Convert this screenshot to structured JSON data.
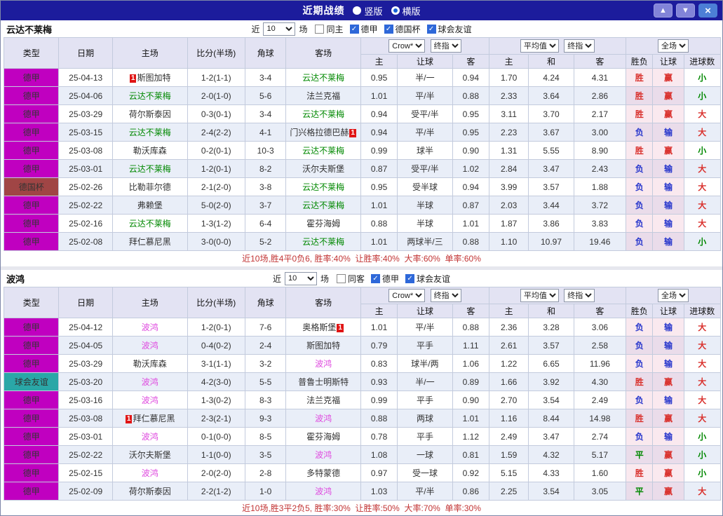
{
  "colors": {
    "titlebar_bg": "#1c1c9c",
    "type": {
      "德甲": "#c000c0",
      "德国杯": "#a04545",
      "球会友谊": "#2aa7a7"
    },
    "text": {
      "green": "#008800",
      "pink": "#df4bdf",
      "red": "#d9302c",
      "blue": "#2736cc"
    }
  },
  "titlebar": {
    "title": "近期战绩",
    "view_options": [
      {
        "label": "竖版",
        "selected": false
      },
      {
        "label": "横版",
        "selected": true
      }
    ],
    "buttons": {
      "up": "▲",
      "down": "▼",
      "close": "×"
    }
  },
  "sections": [
    {
      "team": "云达不莱梅",
      "filter": {
        "prefix": "近",
        "count": "10",
        "suffix": "场",
        "checkboxes": [
          {
            "label": "同主",
            "checked": false
          },
          {
            "label": "德甲",
            "checked": true
          },
          {
            "label": "德国杯",
            "checked": true
          },
          {
            "label": "球会友谊",
            "checked": true
          }
        ]
      },
      "header": {
        "cols": [
          "类型",
          "日期",
          "主场",
          "比分(半场)",
          "角球",
          "客场"
        ],
        "asian_selects": [
          "Crow*",
          "终指"
        ],
        "euro_selects": [
          "平均值",
          "终指"
        ],
        "result_select": "全场",
        "subcols": [
          "主",
          "让球",
          "客",
          "主",
          "和",
          "客",
          "胜负",
          "让球",
          "进球数"
        ]
      },
      "rows": [
        {
          "type": "德甲",
          "date": "25-04-13",
          "home": {
            "name": "斯图加特",
            "badge": "1",
            "badge_pos": "before"
          },
          "score": "1-2(1-1)",
          "corner": "3-4",
          "away": {
            "name": "云达不莱梅",
            "color": "green"
          },
          "asian": [
            "0.95",
            "半/一",
            "0.94"
          ],
          "euro": [
            "1.70",
            "4.24",
            "4.31"
          ],
          "result": {
            "text": "胜",
            "color": "red"
          },
          "handicap": {
            "text": "赢",
            "color": "red"
          },
          "goals": {
            "text": "小",
            "color": "green"
          }
        },
        {
          "type": "德甲",
          "date": "25-04-06",
          "home": {
            "name": "云达不莱梅",
            "color": "green"
          },
          "score": "2-0(1-0)",
          "corner": "5-6",
          "away": {
            "name": "法兰克福"
          },
          "asian": [
            "1.01",
            "平/半",
            "0.88"
          ],
          "euro": [
            "2.33",
            "3.64",
            "2.86"
          ],
          "result": {
            "text": "胜",
            "color": "red"
          },
          "handicap": {
            "text": "赢",
            "color": "red"
          },
          "goals": {
            "text": "小",
            "color": "green"
          }
        },
        {
          "type": "德甲",
          "date": "25-03-29",
          "home": {
            "name": "荷尔斯泰因"
          },
          "score": "0-3(0-1)",
          "corner": "3-4",
          "away": {
            "name": "云达不莱梅",
            "color": "green"
          },
          "asian": [
            "0.94",
            "受平/半",
            "0.95"
          ],
          "euro": [
            "3.11",
            "3.70",
            "2.17"
          ],
          "result": {
            "text": "胜",
            "color": "red"
          },
          "handicap": {
            "text": "赢",
            "color": "red"
          },
          "goals": {
            "text": "大",
            "color": "red"
          }
        },
        {
          "type": "德甲",
          "date": "25-03-15",
          "home": {
            "name": "云达不莱梅",
            "color": "green"
          },
          "score": "2-4(2-2)",
          "corner": "4-1",
          "away": {
            "name": "门兴格拉德巴赫",
            "badge": "1",
            "badge_pos": "after"
          },
          "asian": [
            "0.94",
            "平/半",
            "0.95"
          ],
          "euro": [
            "2.23",
            "3.67",
            "3.00"
          ],
          "result": {
            "text": "负",
            "color": "blue"
          },
          "handicap": {
            "text": "输",
            "color": "blue"
          },
          "goals": {
            "text": "大",
            "color": "red"
          }
        },
        {
          "type": "德甲",
          "date": "25-03-08",
          "home": {
            "name": "勒沃库森"
          },
          "score": "0-2(0-1)",
          "corner": "10-3",
          "away": {
            "name": "云达不莱梅",
            "color": "green"
          },
          "asian": [
            "0.99",
            "球半",
            "0.90"
          ],
          "euro": [
            "1.31",
            "5.55",
            "8.90"
          ],
          "result": {
            "text": "胜",
            "color": "red"
          },
          "handicap": {
            "text": "赢",
            "color": "red"
          },
          "goals": {
            "text": "小",
            "color": "green"
          }
        },
        {
          "type": "德甲",
          "date": "25-03-01",
          "home": {
            "name": "云达不莱梅",
            "color": "green"
          },
          "score": "1-2(0-1)",
          "corner": "8-2",
          "away": {
            "name": "沃尔夫斯堡"
          },
          "asian": [
            "0.87",
            "受平/半",
            "1.02"
          ],
          "euro": [
            "2.84",
            "3.47",
            "2.43"
          ],
          "result": {
            "text": "负",
            "color": "blue"
          },
          "handicap": {
            "text": "输",
            "color": "blue"
          },
          "goals": {
            "text": "大",
            "color": "red"
          }
        },
        {
          "type": "德国杯",
          "date": "25-02-26",
          "home": {
            "name": "比勒菲尔德"
          },
          "score": "2-1(2-0)",
          "corner": "3-8",
          "away": {
            "name": "云达不莱梅",
            "color": "green"
          },
          "asian": [
            "0.95",
            "受半球",
            "0.94"
          ],
          "euro": [
            "3.99",
            "3.57",
            "1.88"
          ],
          "result": {
            "text": "负",
            "color": "blue"
          },
          "handicap": {
            "text": "输",
            "color": "blue"
          },
          "goals": {
            "text": "大",
            "color": "red"
          }
        },
        {
          "type": "德甲",
          "date": "25-02-22",
          "home": {
            "name": "弗赖堡"
          },
          "score": "5-0(2-0)",
          "corner": "3-7",
          "away": {
            "name": "云达不莱梅",
            "color": "green"
          },
          "asian": [
            "1.01",
            "半球",
            "0.87"
          ],
          "euro": [
            "2.03",
            "3.44",
            "3.72"
          ],
          "result": {
            "text": "负",
            "color": "blue"
          },
          "handicap": {
            "text": "输",
            "color": "blue"
          },
          "goals": {
            "text": "大",
            "color": "red"
          }
        },
        {
          "type": "德甲",
          "date": "25-02-16",
          "home": {
            "name": "云达不莱梅",
            "color": "green"
          },
          "score": "1-3(1-2)",
          "corner": "6-4",
          "away": {
            "name": "霍芬海姆"
          },
          "asian": [
            "0.88",
            "半球",
            "1.01"
          ],
          "euro": [
            "1.87",
            "3.86",
            "3.83"
          ],
          "result": {
            "text": "负",
            "color": "blue"
          },
          "handicap": {
            "text": "输",
            "color": "blue"
          },
          "goals": {
            "text": "大",
            "color": "red"
          }
        },
        {
          "type": "德甲",
          "date": "25-02-08",
          "home": {
            "name": "拜仁慕尼黑"
          },
          "score": "3-0(0-0)",
          "corner": "5-2",
          "away": {
            "name": "云达不莱梅",
            "color": "green"
          },
          "asian": [
            "1.01",
            "两球半/三",
            "0.88"
          ],
          "euro": [
            "1.10",
            "10.97",
            "19.46"
          ],
          "result": {
            "text": "负",
            "color": "blue"
          },
          "handicap": {
            "text": "输",
            "color": "blue"
          },
          "goals": {
            "text": "小",
            "color": "green"
          }
        }
      ],
      "footer": "近10场,胜4平0负6, 胜率:40%  让胜率:40%  大率:60%  单率:60%"
    },
    {
      "team": "波鸿",
      "filter": {
        "prefix": "近",
        "count": "10",
        "suffix": "场",
        "checkboxes": [
          {
            "label": "同客",
            "checked": false
          },
          {
            "label": "德甲",
            "checked": true
          },
          {
            "label": "球会友谊",
            "checked": true
          }
        ]
      },
      "header": {
        "cols": [
          "类型",
          "日期",
          "主场",
          "比分(半场)",
          "角球",
          "客场"
        ],
        "asian_selects": [
          "Crow*",
          "终指"
        ],
        "euro_selects": [
          "平均值",
          "终指"
        ],
        "result_select": "全场",
        "subcols": [
          "主",
          "让球",
          "客",
          "主",
          "和",
          "客",
          "胜负",
          "让球",
          "进球数"
        ]
      },
      "rows": [
        {
          "type": "德甲",
          "date": "25-04-12",
          "home": {
            "name": "波鸿",
            "color": "pink"
          },
          "score": "1-2(0-1)",
          "corner": "7-6",
          "away": {
            "name": "奥格斯堡",
            "badge": "1",
            "badge_pos": "after"
          },
          "asian": [
            "1.01",
            "平/半",
            "0.88"
          ],
          "euro": [
            "2.36",
            "3.28",
            "3.06"
          ],
          "result": {
            "text": "负",
            "color": "blue"
          },
          "handicap": {
            "text": "输",
            "color": "blue"
          },
          "goals": {
            "text": "大",
            "color": "red"
          }
        },
        {
          "type": "德甲",
          "date": "25-04-05",
          "home": {
            "name": "波鸿",
            "color": "pink"
          },
          "score": "0-4(0-2)",
          "corner": "2-4",
          "away": {
            "name": "斯图加特"
          },
          "asian": [
            "0.79",
            "平手",
            "1.11"
          ],
          "euro": [
            "2.61",
            "3.57",
            "2.58"
          ],
          "result": {
            "text": "负",
            "color": "blue"
          },
          "handicap": {
            "text": "输",
            "color": "blue"
          },
          "goals": {
            "text": "大",
            "color": "red"
          }
        },
        {
          "type": "德甲",
          "date": "25-03-29",
          "home": {
            "name": "勒沃库森"
          },
          "score": "3-1(1-1)",
          "corner": "3-2",
          "away": {
            "name": "波鸿",
            "color": "pink"
          },
          "asian": [
            "0.83",
            "球半/两",
            "1.06"
          ],
          "euro": [
            "1.22",
            "6.65",
            "11.96"
          ],
          "result": {
            "text": "负",
            "color": "blue"
          },
          "handicap": {
            "text": "输",
            "color": "blue"
          },
          "goals": {
            "text": "大",
            "color": "red"
          }
        },
        {
          "type": "球会友谊",
          "date": "25-03-20",
          "home": {
            "name": "波鸿",
            "color": "pink"
          },
          "score": "4-2(3-0)",
          "corner": "5-5",
          "away": {
            "name": "普鲁士明斯特"
          },
          "asian": [
            "0.93",
            "半/一",
            "0.89"
          ],
          "euro": [
            "1.66",
            "3.92",
            "4.30"
          ],
          "result": {
            "text": "胜",
            "color": "red"
          },
          "handicap": {
            "text": "赢",
            "color": "red"
          },
          "goals": {
            "text": "大",
            "color": "red"
          }
        },
        {
          "type": "德甲",
          "date": "25-03-16",
          "home": {
            "name": "波鸿",
            "color": "pink"
          },
          "score": "1-3(0-2)",
          "corner": "8-3",
          "away": {
            "name": "法兰克福"
          },
          "asian": [
            "0.99",
            "平手",
            "0.90"
          ],
          "euro": [
            "2.70",
            "3.54",
            "2.49"
          ],
          "result": {
            "text": "负",
            "color": "blue"
          },
          "handicap": {
            "text": "输",
            "color": "blue"
          },
          "goals": {
            "text": "大",
            "color": "red"
          }
        },
        {
          "type": "德甲",
          "date": "25-03-08",
          "home": {
            "name": "拜仁慕尼黑",
            "badge": "1",
            "badge_pos": "before"
          },
          "score": "2-3(2-1)",
          "corner": "9-3",
          "away": {
            "name": "波鸿",
            "color": "pink"
          },
          "asian": [
            "0.88",
            "两球",
            "1.01"
          ],
          "euro": [
            "1.16",
            "8.44",
            "14.98"
          ],
          "result": {
            "text": "胜",
            "color": "red"
          },
          "handicap": {
            "text": "赢",
            "color": "red"
          },
          "goals": {
            "text": "大",
            "color": "red"
          }
        },
        {
          "type": "德甲",
          "date": "25-03-01",
          "home": {
            "name": "波鸿",
            "color": "pink"
          },
          "score": "0-1(0-0)",
          "corner": "8-5",
          "away": {
            "name": "霍芬海姆"
          },
          "asian": [
            "0.78",
            "平手",
            "1.12"
          ],
          "euro": [
            "2.49",
            "3.47",
            "2.74"
          ],
          "result": {
            "text": "负",
            "color": "blue"
          },
          "handicap": {
            "text": "输",
            "color": "blue"
          },
          "goals": {
            "text": "小",
            "color": "green"
          }
        },
        {
          "type": "德甲",
          "date": "25-02-22",
          "home": {
            "name": "沃尔夫斯堡"
          },
          "score": "1-1(0-0)",
          "corner": "3-5",
          "away": {
            "name": "波鸿",
            "color": "pink"
          },
          "asian": [
            "1.08",
            "一球",
            "0.81"
          ],
          "euro": [
            "1.59",
            "4.32",
            "5.17"
          ],
          "result": {
            "text": "平",
            "color": "green"
          },
          "handicap": {
            "text": "赢",
            "color": "red"
          },
          "goals": {
            "text": "小",
            "color": "green"
          }
        },
        {
          "type": "德甲",
          "date": "25-02-15",
          "home": {
            "name": "波鸿",
            "color": "pink"
          },
          "score": "2-0(2-0)",
          "corner": "2-8",
          "away": {
            "name": "多特蒙德"
          },
          "asian": [
            "0.97",
            "受一球",
            "0.92"
          ],
          "euro": [
            "5.15",
            "4.33",
            "1.60"
          ],
          "result": {
            "text": "胜",
            "color": "red"
          },
          "handicap": {
            "text": "赢",
            "color": "red"
          },
          "goals": {
            "text": "小",
            "color": "green"
          }
        },
        {
          "type": "德甲",
          "date": "25-02-09",
          "home": {
            "name": "荷尔斯泰因"
          },
          "score": "2-2(1-2)",
          "corner": "1-0",
          "away": {
            "name": "波鸿",
            "color": "pink"
          },
          "asian": [
            "1.03",
            "平/半",
            "0.86"
          ],
          "euro": [
            "2.25",
            "3.54",
            "3.05"
          ],
          "result": {
            "text": "平",
            "color": "green"
          },
          "handicap": {
            "text": "赢",
            "color": "red"
          },
          "goals": {
            "text": "大",
            "color": "red"
          }
        }
      ],
      "footer": "近10场,胜3平2负5, 胜率:30%  让胜率:50%  大率:70%  单率:30%"
    }
  ]
}
